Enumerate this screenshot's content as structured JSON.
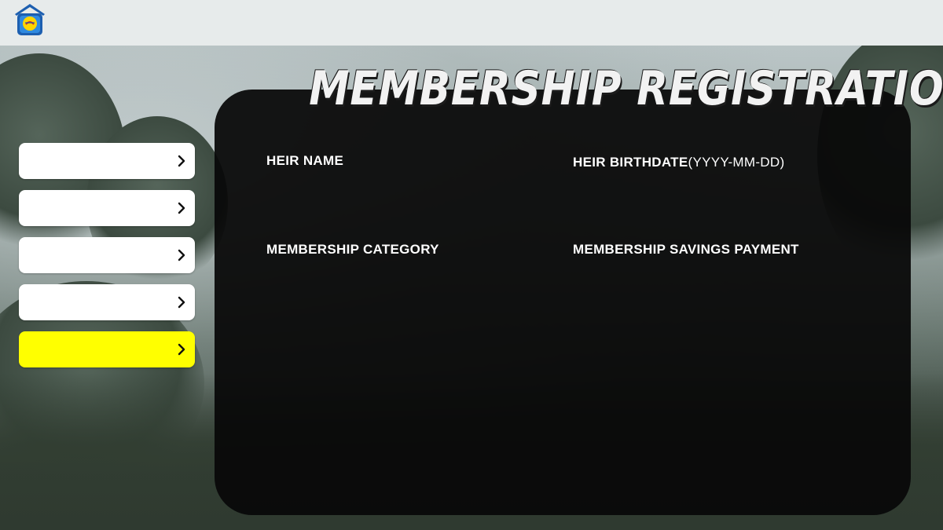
{
  "header": {
    "logo_icon": "pag-ibig-house-logo-icon"
  },
  "page": {
    "title": "MEMBERSHIP REGISTRATION"
  },
  "sidebar": {
    "items": [
      {
        "label": "",
        "icon": "chevron-right-icon",
        "active": false
      },
      {
        "label": "",
        "icon": "chevron-right-icon",
        "active": false
      },
      {
        "label": "",
        "icon": "chevron-right-icon",
        "active": false
      },
      {
        "label": "",
        "icon": "chevron-right-icon",
        "active": false
      },
      {
        "label": "",
        "icon": "chevron-right-icon",
        "active": true
      }
    ],
    "active_color": "#ffff00",
    "item_color": "#ffffff"
  },
  "form": {
    "heir_name_label": "HEIR NAME",
    "heir_birthdate_label": "HEIR BIRTHDATE",
    "heir_birthdate_hint": "(YYYY-MM-DD)",
    "membership_category_label": "MEMBERSHIP CATEGORY",
    "membership_savings_payment_label": "MEMBERSHIP SAVINGS PAYMENT"
  },
  "colors": {
    "panel": "#080808",
    "topbar": "#e7ebeb",
    "text": "#ffffff"
  }
}
